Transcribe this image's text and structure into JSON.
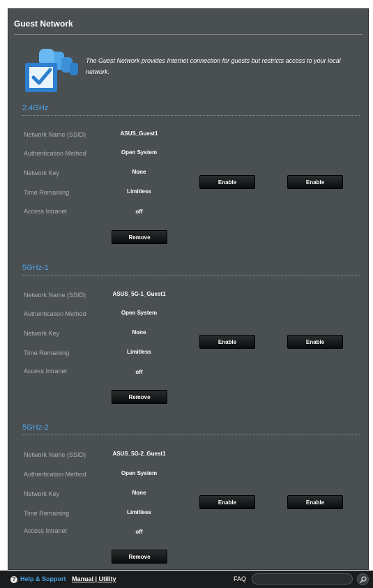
{
  "panel": {
    "title": "Guest Network",
    "intro": "The Guest Network provides Internet connection for guests but restricts access to your local network."
  },
  "labels": {
    "ssid": "Network Name (SSID)",
    "auth": "Authentication Method",
    "key": "Network Key",
    "time": "Time Remaining",
    "intranet": "Access Intranet"
  },
  "buttons": {
    "enable": "Enable",
    "remove": "Remove"
  },
  "bands": [
    {
      "title": "2.4GHz",
      "ssid": "ASUS_Guest1",
      "auth": "Open System",
      "key": "None",
      "time": "Limitless",
      "intranet": "off"
    },
    {
      "title": "5GHz-1",
      "ssid": "ASUS_5G-1_Guest1",
      "auth": "Open System",
      "key": "None",
      "time": "Limitless",
      "intranet": "off"
    },
    {
      "title": "5GHz-2",
      "ssid": "ASUS_5G-2_Guest1",
      "auth": "Open System",
      "key": "None",
      "time": "Limitless",
      "intranet": "off"
    }
  ],
  "footer": {
    "help": "Help & Support",
    "manual": "Manual | Utility",
    "faq": "FAQ",
    "faq_placeholder": ""
  },
  "icons": {
    "help": "help-circle-icon",
    "search": "search-icon",
    "guest": "guest-network-icon"
  },
  "colors": {
    "panel": "#4a4f52",
    "accent": "#4aa3e6",
    "label": "#a9aeb1"
  }
}
